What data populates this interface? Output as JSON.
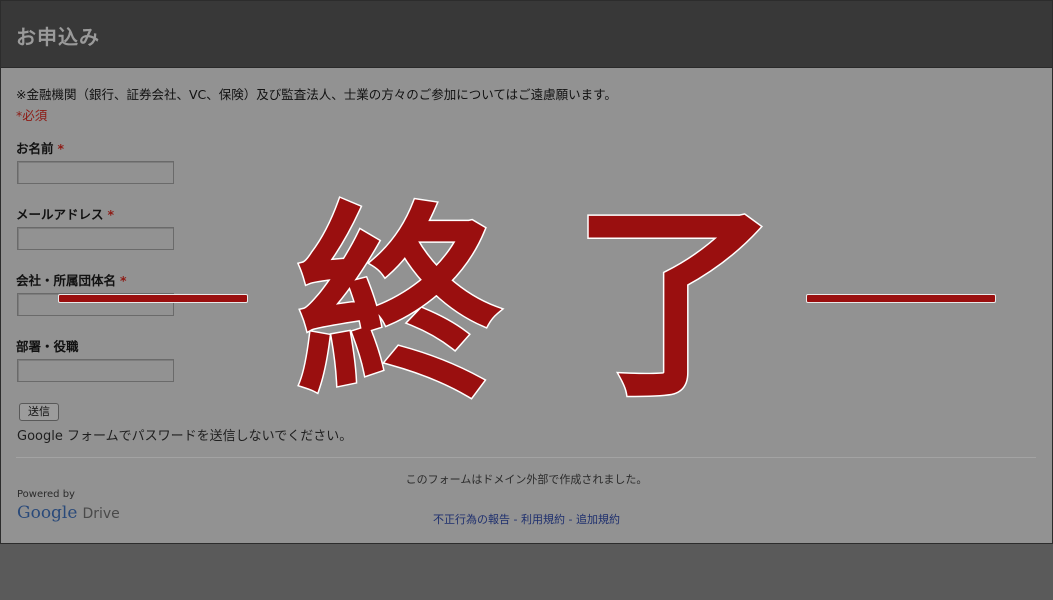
{
  "header": {
    "title": "お申込み"
  },
  "form": {
    "notice": "※金融機関（銀行、証券会社、VC、保険）及び監査法人、士業の方々のご参加についてはご遠慮願います。",
    "required_note": "*必須",
    "fields": [
      {
        "label": "お名前",
        "required": "*",
        "value": ""
      },
      {
        "label": "メールアドレス",
        "required": "*",
        "value": ""
      },
      {
        "label": "会社・所属団体名",
        "required": "*",
        "value": ""
      },
      {
        "label": "部署・役職",
        "required": "",
        "value": ""
      }
    ],
    "submit_label": "送信",
    "password_warning": "Google フォームでパスワードを送信しないでください。"
  },
  "footer": {
    "domain_note": "このフォームはドメイン外部で作成されました。",
    "powered_by": "Powered by",
    "logo_text": "Google",
    "logo_sub": "Drive",
    "links": [
      {
        "label": "不正行為の報告"
      },
      {
        "label": "利用規約"
      },
      {
        "label": "追加規約"
      }
    ],
    "link_separator": " - "
  },
  "overlay": {
    "text": "終了",
    "color": "#9a0f0f"
  }
}
